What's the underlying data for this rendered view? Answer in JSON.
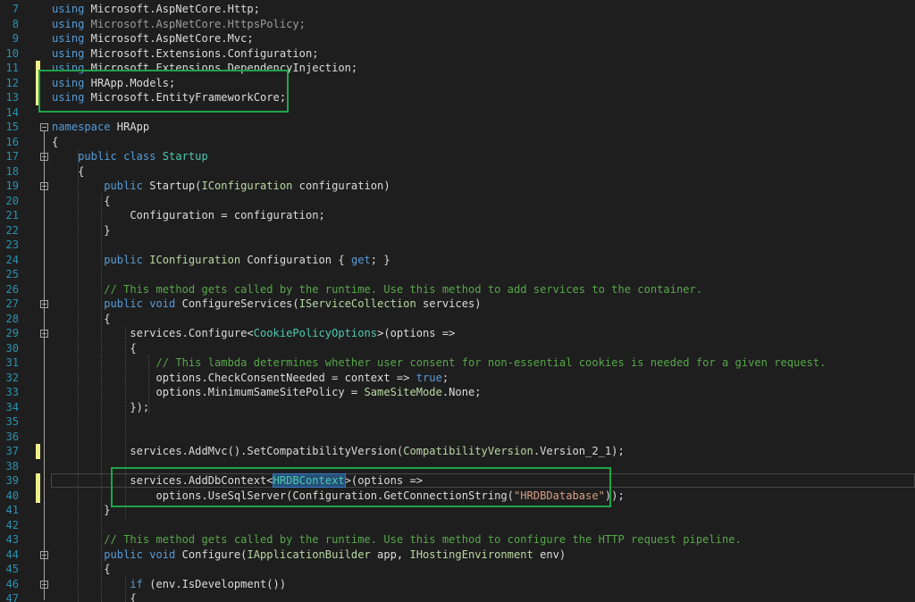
{
  "editor": {
    "lines": [
      {
        "num": "7",
        "tokens": [
          {
            "t": "keyword",
            "v": "using"
          },
          {
            "t": "plain",
            "v": " Microsoft.AspNetCore.Http;"
          }
        ]
      },
      {
        "num": "8",
        "tokens": [
          {
            "t": "keyword",
            "v": "using"
          },
          {
            "t": "dim",
            "v": " Microsoft.AspNetCore.HttpsPolicy;"
          }
        ]
      },
      {
        "num": "9",
        "tokens": [
          {
            "t": "keyword",
            "v": "using"
          },
          {
            "t": "plain",
            "v": " Microsoft.AspNetCore.Mvc;"
          }
        ]
      },
      {
        "num": "10",
        "tokens": [
          {
            "t": "keyword",
            "v": "using"
          },
          {
            "t": "plain",
            "v": " Microsoft.Extensions.Configuration;"
          }
        ]
      },
      {
        "num": "11",
        "tokens": [
          {
            "t": "keyword",
            "v": "using"
          },
          {
            "t": "plain",
            "v": " Microsoft.Extensions.DependencyInjection;"
          }
        ]
      },
      {
        "num": "12",
        "tokens": [
          {
            "t": "keyword",
            "v": "using"
          },
          {
            "t": "plain",
            "v": " HRApp.Models;"
          }
        ]
      },
      {
        "num": "13",
        "tokens": [
          {
            "t": "keyword",
            "v": "using"
          },
          {
            "t": "plain",
            "v": " Microsoft.EntityFrameworkCore;"
          }
        ]
      },
      {
        "num": "14",
        "tokens": []
      },
      {
        "num": "15",
        "tokens": [
          {
            "t": "keyword",
            "v": "namespace"
          },
          {
            "t": "plain",
            "v": " HRApp"
          }
        ]
      },
      {
        "num": "16",
        "tokens": [
          {
            "t": "plain",
            "v": "{"
          }
        ]
      },
      {
        "num": "17",
        "tokens": [
          {
            "t": "plain",
            "v": "    "
          },
          {
            "t": "keyword",
            "v": "public class"
          },
          {
            "t": "plain",
            "v": " "
          },
          {
            "t": "type",
            "v": "Startup"
          }
        ]
      },
      {
        "num": "18",
        "tokens": [
          {
            "t": "plain",
            "v": "    {"
          }
        ]
      },
      {
        "num": "19",
        "tokens": [
          {
            "t": "plain",
            "v": "        "
          },
          {
            "t": "keyword",
            "v": "public"
          },
          {
            "t": "plain",
            "v": " Startup("
          },
          {
            "t": "iface",
            "v": "IConfiguration"
          },
          {
            "t": "plain",
            "v": " configuration)"
          }
        ]
      },
      {
        "num": "20",
        "tokens": [
          {
            "t": "plain",
            "v": "        {"
          }
        ]
      },
      {
        "num": "21",
        "tokens": [
          {
            "t": "plain",
            "v": "            Configuration = configuration;"
          }
        ]
      },
      {
        "num": "22",
        "tokens": [
          {
            "t": "plain",
            "v": "        }"
          }
        ]
      },
      {
        "num": "23",
        "tokens": []
      },
      {
        "num": "24",
        "tokens": [
          {
            "t": "plain",
            "v": "        "
          },
          {
            "t": "keyword",
            "v": "public"
          },
          {
            "t": "plain",
            "v": " "
          },
          {
            "t": "iface",
            "v": "IConfiguration"
          },
          {
            "t": "plain",
            "v": " Configuration { "
          },
          {
            "t": "keyword",
            "v": "get"
          },
          {
            "t": "plain",
            "v": "; }"
          }
        ]
      },
      {
        "num": "25",
        "tokens": []
      },
      {
        "num": "26",
        "tokens": [
          {
            "t": "plain",
            "v": "        "
          },
          {
            "t": "comment",
            "v": "// This method gets called by the runtime. Use this method to add services to the container."
          }
        ]
      },
      {
        "num": "27",
        "tokens": [
          {
            "t": "plain",
            "v": "        "
          },
          {
            "t": "keyword",
            "v": "public void"
          },
          {
            "t": "plain",
            "v": " ConfigureServices("
          },
          {
            "t": "iface",
            "v": "IServiceCollection"
          },
          {
            "t": "plain",
            "v": " services)"
          }
        ]
      },
      {
        "num": "28",
        "tokens": [
          {
            "t": "plain",
            "v": "        {"
          }
        ]
      },
      {
        "num": "29",
        "tokens": [
          {
            "t": "plain",
            "v": "            services.Configure<"
          },
          {
            "t": "type",
            "v": "CookiePolicyOptions"
          },
          {
            "t": "plain",
            "v": ">(options =>"
          }
        ]
      },
      {
        "num": "30",
        "tokens": [
          {
            "t": "plain",
            "v": "            {"
          }
        ]
      },
      {
        "num": "31",
        "tokens": [
          {
            "t": "plain",
            "v": "                "
          },
          {
            "t": "comment",
            "v": "// This lambda determines whether user consent for non-essential cookies is needed for a given request."
          }
        ]
      },
      {
        "num": "32",
        "tokens": [
          {
            "t": "plain",
            "v": "                options.CheckConsentNeeded = context => "
          },
          {
            "t": "keyword",
            "v": "true"
          },
          {
            "t": "plain",
            "v": ";"
          }
        ]
      },
      {
        "num": "33",
        "tokens": [
          {
            "t": "plain",
            "v": "                options.MinimumSameSitePolicy = "
          },
          {
            "t": "iface",
            "v": "SameSiteMode"
          },
          {
            "t": "plain",
            "v": ".None;"
          }
        ]
      },
      {
        "num": "34",
        "tokens": [
          {
            "t": "plain",
            "v": "            });"
          }
        ]
      },
      {
        "num": "35",
        "tokens": []
      },
      {
        "num": "36",
        "tokens": []
      },
      {
        "num": "37",
        "tokens": [
          {
            "t": "plain",
            "v": "            services.AddMvc().SetCompatibilityVersion("
          },
          {
            "t": "iface",
            "v": "CompatibilityVersion"
          },
          {
            "t": "plain",
            "v": ".Version_2_1);"
          }
        ]
      },
      {
        "num": "38",
        "tokens": []
      },
      {
        "num": "39",
        "tokens": [
          {
            "t": "plain",
            "v": "            services.AddDbContext<"
          },
          {
            "t": "sel",
            "v": "HRDBContext"
          },
          {
            "t": "plain",
            "v": ">(options =>"
          }
        ]
      },
      {
        "num": "40",
        "tokens": [
          {
            "t": "plain",
            "v": "                options.UseSqlServer(Configuration.GetConnectionString("
          },
          {
            "t": "string",
            "v": "\"HRDBDatabase\""
          },
          {
            "t": "plain",
            "v": "));"
          }
        ]
      },
      {
        "num": "41",
        "tokens": [
          {
            "t": "plain",
            "v": "        }"
          }
        ]
      },
      {
        "num": "42",
        "tokens": []
      },
      {
        "num": "43",
        "tokens": [
          {
            "t": "plain",
            "v": "        "
          },
          {
            "t": "comment",
            "v": "// This method gets called by the runtime. Use this method to configure the HTTP request pipeline."
          }
        ]
      },
      {
        "num": "44",
        "tokens": [
          {
            "t": "plain",
            "v": "        "
          },
          {
            "t": "keyword",
            "v": "public void"
          },
          {
            "t": "plain",
            "v": " Configure("
          },
          {
            "t": "iface",
            "v": "IApplicationBuilder"
          },
          {
            "t": "plain",
            "v": " app, "
          },
          {
            "t": "iface",
            "v": "IHostingEnvironment"
          },
          {
            "t": "plain",
            "v": " env)"
          }
        ]
      },
      {
        "num": "45",
        "tokens": [
          {
            "t": "plain",
            "v": "        {"
          }
        ]
      },
      {
        "num": "46",
        "tokens": [
          {
            "t": "plain",
            "v": "            "
          },
          {
            "t": "keyword",
            "v": "if"
          },
          {
            "t": "plain",
            "v": " (env.IsDevelopment())"
          }
        ]
      },
      {
        "num": "47",
        "tokens": [
          {
            "t": "plain",
            "v": "            {"
          }
        ]
      }
    ],
    "changed_lines": [
      "11",
      "12",
      "13",
      "37",
      "39",
      "40"
    ],
    "fold_lines": [
      "15",
      "17",
      "19",
      "27",
      "29",
      "44",
      "46"
    ],
    "caret_line": "39",
    "colors": {
      "background": "#1e1e1e",
      "line_number": "#2b91af",
      "keyword": "#569cd6",
      "type": "#4ec9b0",
      "comment": "#57a64a",
      "string": "#d69d85",
      "change_marker": "#eff089",
      "annotation_box": "#1fa34a"
    }
  }
}
